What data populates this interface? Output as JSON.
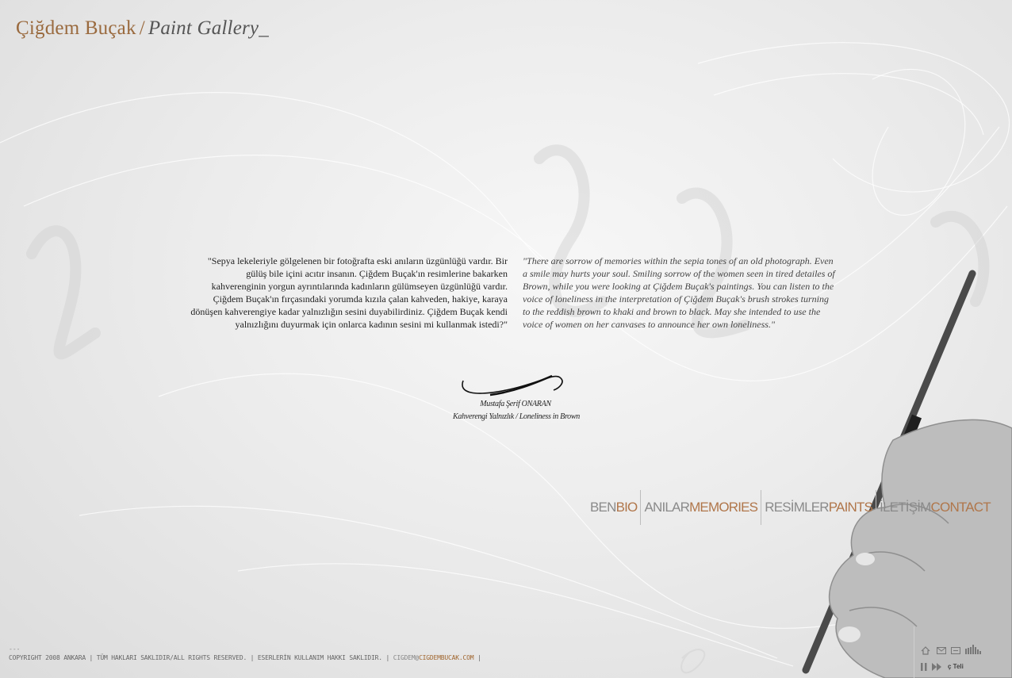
{
  "header": {
    "name": "Çiğdem Buçak",
    "separator": "/",
    "gallery": "Paint Gallery_"
  },
  "quotes": {
    "turkish": "\"Sepya lekeleriyle gölgelenen bir fotoğrafta eski anıların üzgünlüğü vardır. Bir gülüş bile içini acıtır insanın. Çiğdem Buçak'ın resimlerine bakarken kahverenginin yorgun ayrıntılarında kadınların gülümseyen üzgünlüğü vardır. Çiğdem Buçak'ın fırçasındaki yorumda kızıla çalan kahveden, hakiye, karaya dönüşen kahverengiye kadar yalnızlığın sesini duyabilirdiniz. Çiğdem Buçak kendi yalnızlığını duyurmak için onlarca kadının sesini mi kullanmak istedi?\"",
    "english": "\"There are sorrow of memories within the sepia tones of an old photograph. Even a smile may hurts your soul. Smiling sorrow of the women seen in tired detailes of Brown, while you were looking at Çiğdem Buçak's paintings. You can listen to the voice of loneliness in the interpretation of Çiğdem Buçak's brush strokes turning to the reddish brown to khaki and brown to black. May she intended to use the voice of women on her canvases to announce her own loneliness.\""
  },
  "signature": {
    "author": "Mustafa Şerif ONARAN",
    "book": "Kahverengi Yalnızlık / Loneliness in Brown"
  },
  "nav": [
    {
      "tr": "BEN",
      "en": "BIO"
    },
    {
      "tr": "ANILAR",
      "en": "MEMORIES"
    },
    {
      "tr": "RESİMLER",
      "en": "PAINTS"
    },
    {
      "tr": "İLETİŞİM",
      "en": "CONTACT"
    }
  ],
  "footer": {
    "dashes": "---",
    "copyright": "COPYRIGHT 2008 ANKARA  | TÜM HAKLARI SAKLIDIR/ALL RIGHTS RESERVED.  |  ESERLERİN KULLANIM HAKKI SAKLIDIR.  |",
    "email_user": "CIGDEM@",
    "email_domain": "CIGDEMBUCAK.COM",
    "end_sep": "|"
  },
  "tools": {
    "icons": [
      "home-icon",
      "mail-icon",
      "minimize-icon",
      "sound-bars-icon",
      "pause-icon",
      "fast-forward-icon"
    ],
    "language": "ç Teli"
  },
  "colors": {
    "accent": "#9a6a3e",
    "nav_en": "#b0764a",
    "nav_tr": "#8a8a8a"
  }
}
